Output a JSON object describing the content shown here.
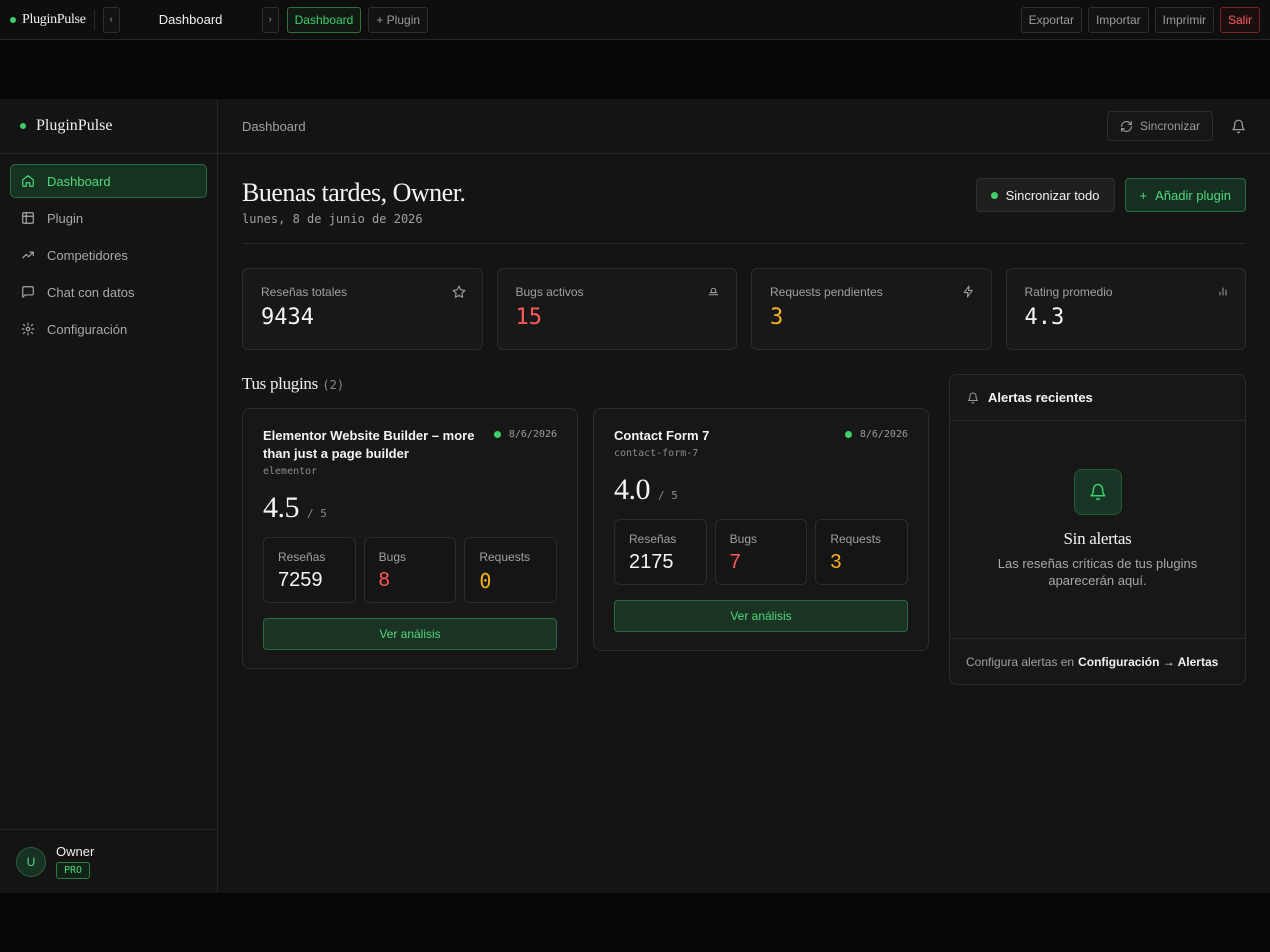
{
  "topbar": {
    "brand": "PluginPulse",
    "title": "Dashboard",
    "nav_prev": "‹",
    "nav_next": "›",
    "tab_dashboard": "Dashboard",
    "tab_plugin": "+ Plugin",
    "export": "Exportar",
    "import": "Importar",
    "print": "Imprimir",
    "exit": "Salir"
  },
  "sidebar": {
    "brand": "PluginPulse",
    "items": [
      {
        "label": "Dashboard",
        "icon": "home-icon",
        "active": true
      },
      {
        "label": "Plugin",
        "icon": "table-icon",
        "active": false
      },
      {
        "label": "Competidores",
        "icon": "trending-up-icon",
        "active": false
      },
      {
        "label": "Chat con datos",
        "icon": "chat-icon",
        "active": false
      },
      {
        "label": "Configuración",
        "icon": "gear-icon",
        "active": false
      }
    ],
    "user": {
      "initial": "U",
      "name": "Owner",
      "plan": "PRO"
    }
  },
  "header": {
    "breadcrumb": "Dashboard",
    "sync_label": "Sincronizar"
  },
  "main": {
    "greeting": "Buenas tardes, Owner.",
    "date": "lunes, 8 de junio de 2026",
    "sync_all": "Sincronizar todo",
    "add_plugin": "Añadir plugin"
  },
  "stats": [
    {
      "label": "Reseñas totales",
      "value": "9434",
      "icon": "star-icon"
    },
    {
      "label": "Bugs activos",
      "value": "15",
      "icon": "bug-icon"
    },
    {
      "label": "Requests pendientes",
      "value": "3",
      "icon": "bolt-icon"
    },
    {
      "label": "Rating promedio",
      "value": "4.3",
      "icon": "bar-chart-icon"
    }
  ],
  "plugins_section": {
    "title": "Tus plugins",
    "count": "(2)"
  },
  "plugins": [
    {
      "name": "Elementor Website Builder – more than just a page builder",
      "slug": "elementor",
      "date": "8/6/2026",
      "rating": "4.5",
      "rating_max": "/ 5",
      "reviews_label": "Reseñas",
      "reviews": "7259",
      "bugs_label": "Bugs",
      "bugs": "8",
      "requests_label": "Requests",
      "requests": "0",
      "action": "Ver análisis"
    },
    {
      "name": "Contact Form 7",
      "slug": "contact-form-7",
      "date": "8/6/2026",
      "rating": "4.0",
      "rating_max": "/ 5",
      "reviews_label": "Reseñas",
      "reviews": "2175",
      "bugs_label": "Bugs",
      "bugs": "7",
      "requests_label": "Requests",
      "requests": "3",
      "action": "Ver análisis"
    }
  ],
  "alerts": {
    "title": "Alertas recientes",
    "empty_title": "Sin alertas",
    "empty_text": "Las reseñas críticas de tus plugins aparecerán aquí.",
    "footer_text": "Configura alertas en",
    "footer_link": "Configuración → Alertas"
  },
  "colors": {
    "accent": "#3ecf6a",
    "danger": "#ff5a5a",
    "warning": "#f5b21d",
    "background": "#131413"
  }
}
